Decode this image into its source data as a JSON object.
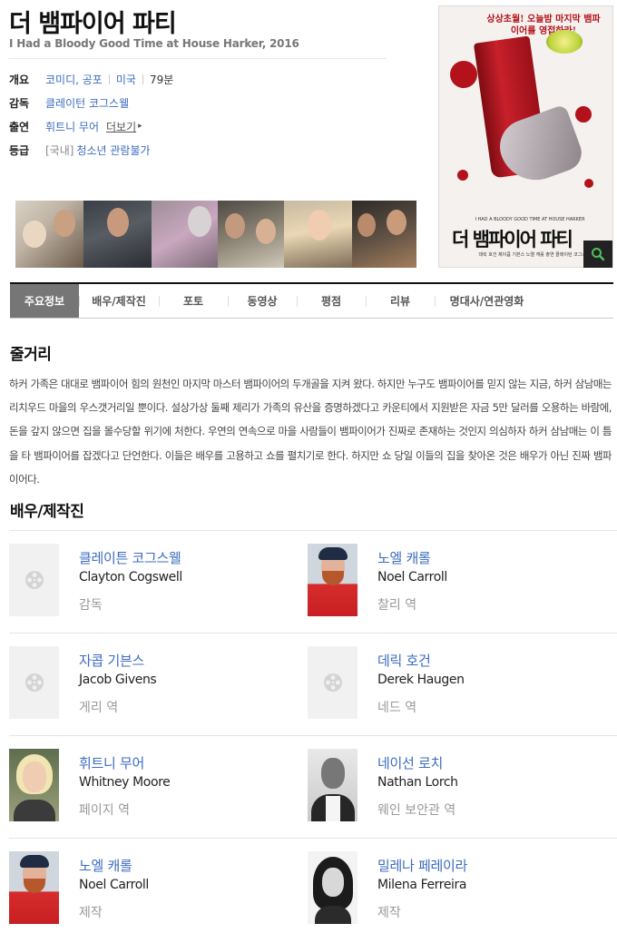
{
  "movie": {
    "title": "더 뱀파이어 파티",
    "original_title": "I Had a Bloody Good Time at House Harker, 2016"
  },
  "info": {
    "overview_key": "개요",
    "genre": "코미디, 공포",
    "country": "미국",
    "runtime": "79분",
    "director_key": "감독",
    "director": "클레이턴 코그스웰",
    "cast_key": "출연",
    "lead_actor": "휘트니 무어",
    "more_label": "더보기",
    "rating_key": "등급",
    "rating_prefix": "[국내]",
    "rating": "청소년 관람불가"
  },
  "poster": {
    "tagline": "상상초월! 오늘밤 마지막 뱀파이어를 영접하라!",
    "title_text": "더 뱀파이어 파티",
    "small_credit": "I HAD A BLOODY GOOD TIME AT HOUSE HARKER",
    "cast_credit": "데릭 호건  제이콥 기븐스  노엘 캐롤  출연  클레이턴 코그스웰",
    "zoom_icon": "search-icon"
  },
  "stills": [
    "still-1",
    "still-2",
    "still-3",
    "still-4",
    "still-5",
    "still-6"
  ],
  "tabs": [
    {
      "label": "주요정보",
      "active": true
    },
    {
      "label": "배우/제작진"
    },
    {
      "label": "포토"
    },
    {
      "label": "동영상"
    },
    {
      "label": "평점"
    },
    {
      "label": "리뷰"
    },
    {
      "label": "명대사/연관영화"
    }
  ],
  "synopsis": {
    "heading": "줄거리",
    "text": "하커 가족은 대대로 뱀파이어 힘의 원천인 마지막 마스터 뱀파이어의 두개골을 지켜 왔다. 하지만 누구도 뱀파이어를 믿지 않는 지금, 하커 삼남매는 리치우드 마을의 우스갯거리일 뿐이다. 설상가상 둘째 제리가 가족의 유산을 증명하겠다고 카운티에서 지원받은 자금 5만 달러를 오용하는 바람에, 돈을 갚지 않으면 집을 몰수당할 위기에 처한다. 우연의 연속으로 마을 사람들이 뱀파이어가 진짜로 존재하는 것인지 의심하자 하커 삼남매는 이 틈을 타 뱀파이어를 잡겠다고 단언한다. 이들은 배우를 고용하고 쇼를 펼치기로 한다. 하지만 쇼 당일 이들의 집을 찾아온 것은 배우가 아닌 진짜 뱀파이어다."
  },
  "cast": {
    "heading": "배우/제작진",
    "people": [
      {
        "kor": "클레이튼 코그스웰",
        "eng": "Clayton Cogswell",
        "role": "감독",
        "photo": "film-reel-icon"
      },
      {
        "kor": "노엘 캐롤",
        "eng": "Noel Carroll",
        "role": "찰리 역",
        "photo": "red-shirt"
      },
      {
        "kor": "자콥 기븐스",
        "eng": "Jacob Givens",
        "role": "게리 역",
        "photo": "film-reel-icon"
      },
      {
        "kor": "데릭 호건",
        "eng": "Derek Haugen",
        "role": "네드 역",
        "photo": "film-reel-icon"
      },
      {
        "kor": "휘트니 무어",
        "eng": "Whitney Moore",
        "role": "페이지 역",
        "photo": "blonde"
      },
      {
        "kor": "네이선 로치",
        "eng": "Nathan Lorch",
        "role": "웨인 보안관 역",
        "photo": "bw"
      },
      {
        "kor": "노엘 캐롤",
        "eng": "Noel Carroll",
        "role": "제작",
        "photo": "red-shirt"
      },
      {
        "kor": "밀레나 페레이라",
        "eng": "Milena Ferreira",
        "role": "제작",
        "photo": "dark-hair"
      }
    ]
  },
  "colors": {
    "link": "#3c6cbf",
    "active_tab": "#767676",
    "poster_red": "#b3121b"
  }
}
